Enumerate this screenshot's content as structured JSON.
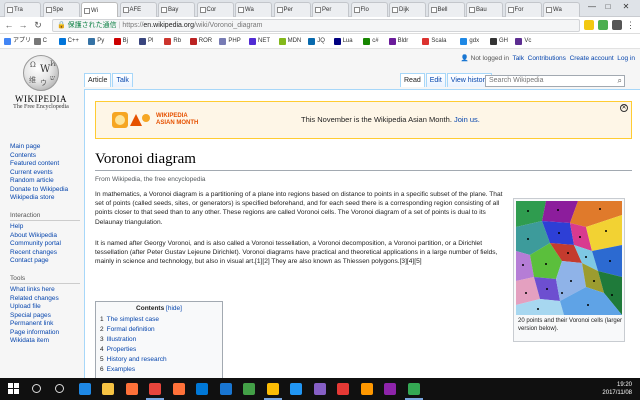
{
  "tabs": [
    "Tra",
    "Spe",
    "Wi",
    "AFE",
    "Bay",
    "Cor",
    "Wa",
    "Per",
    "Per",
    "Flo",
    "Dijk",
    "Bell",
    "Bau",
    "For",
    "Wa"
  ],
  "window_controls": {
    "min": "—",
    "max": "□",
    "close": "✕"
  },
  "address": {
    "secure_label": "保護された通信",
    "scheme": "https://",
    "host": "en.wikipedia.org",
    "path": "/wiki/Voronoi_diagram"
  },
  "bookmarks": [
    "アプリ",
    "C",
    "C++",
    "Py",
    "Bj",
    "Pl",
    "Rb",
    "ROR",
    "PHP",
    "NET",
    "MDN",
    "JQ",
    "Lua",
    "c#",
    "Bldr",
    "Scala",
    "gdx",
    "GH",
    "Vc"
  ],
  "logo": {
    "wordmark": "WIKIPEDIA",
    "tagline": "The Free Encyclopedia",
    "glyphs": [
      "Ω",
      "W",
      "И",
      "维",
      "ウ",
      "ש"
    ]
  },
  "sidebar": {
    "main": [
      "Main page",
      "Contents",
      "Featured content",
      "Current events",
      "Random article",
      "Donate to Wikipedia",
      "Wikipedia store"
    ],
    "interaction_head": "Interaction",
    "interaction": [
      "Help",
      "About Wikipedia",
      "Community portal",
      "Recent changes",
      "Contact page"
    ],
    "tools_head": "Tools",
    "tools": [
      "What links here",
      "Related changes",
      "Upload file",
      "Special pages",
      "Permanent link",
      "Page information",
      "Wikidata item"
    ]
  },
  "user_tools": {
    "not_logged": "Not logged in",
    "talk": "Talk",
    "contributions": "Contributions",
    "create": "Create account",
    "login": "Log in"
  },
  "page_tabs": {
    "article": "Article",
    "talk": "Talk",
    "read": "Read",
    "edit": "Edit",
    "history": "View history"
  },
  "search": {
    "placeholder": "Search Wikipedia"
  },
  "banner": {
    "logo_line1": "WIKIPEDIA",
    "logo_line2": "ASIAN MONTH",
    "message": "This November is the Wikipedia Asian Month.",
    "link": "Join us."
  },
  "article": {
    "title": "Voronoi diagram",
    "from": "From Wikipedia, the free encyclopedia",
    "p1": "In mathematics, a Voronoi diagram is a partitioning of a plane into regions based on distance to points in a specific subset of the plane. That set of points (called seeds, sites, or generators) is specified beforehand, and for each seed there is a corresponding region consisting of all points closer to that seed than to any other. These regions are called Voronoi cells. The Voronoi diagram of a set of points is dual to its Delaunay triangulation.",
    "p2": "It is named after Georgy Voronoi, and is also called a Voronoi tessellation, a Voronoi decomposition, a Voronoi partition, or a Dirichlet tessellation (after Peter Gustav Lejeune Dirichlet). Voronoi diagrams have practical and theoretical applications in a large number of fields, mainly in science and technology, but also in visual art.[1][2] They are also known as Thiessen polygons.[3][4][5]"
  },
  "infobox": {
    "caption": "20 points and their Voronoi cells (larger version below)."
  },
  "toc": {
    "title": "Contents",
    "hide": "[hide]",
    "items": [
      {
        "n": "1",
        "t": "The simplest case"
      },
      {
        "n": "2",
        "t": "Formal definition"
      },
      {
        "n": "3",
        "t": "Illustration"
      },
      {
        "n": "4",
        "t": "Properties"
      },
      {
        "n": "5",
        "t": "History and research"
      },
      {
        "n": "6",
        "t": "Examples"
      }
    ]
  },
  "clock": {
    "time": "19:20",
    "date": "2017/11/08"
  }
}
